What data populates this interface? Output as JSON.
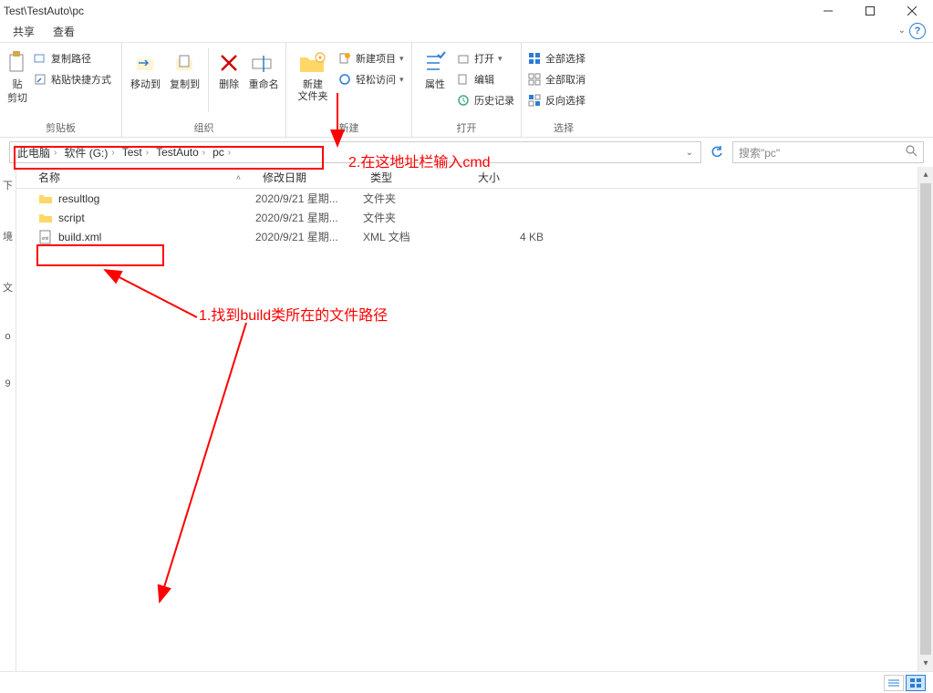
{
  "title_path": "Test\\TestAuto\\pc",
  "menubar": {
    "share": "共享",
    "view": "查看"
  },
  "ribbon": {
    "clipboard": {
      "paste": "贴",
      "cut": "剪切",
      "copy_path": "复制路径",
      "paste_shortcut": "粘贴快捷方式",
      "group": "剪贴板"
    },
    "organize": {
      "move_to": "移动到",
      "copy_to": "复制到",
      "delete": "删除",
      "rename": "重命名",
      "group": "组织"
    },
    "new": {
      "new_folder": "新建\n文件夹",
      "new_item": "新建项目",
      "easy_access": "轻松访问",
      "group": "新建"
    },
    "open_grp": {
      "properties": "属性",
      "open": "打开",
      "edit": "编辑",
      "history": "历史记录",
      "group": "打开"
    },
    "select": {
      "select_all": "全部选择",
      "select_none": "全部取消",
      "invert": "反向选择",
      "group": "选择"
    }
  },
  "breadcrumbs": [
    "此电脑",
    "软件 (G:)",
    "Test",
    "TestAuto",
    "pc"
  ],
  "search_placeholder": "搜索\"pc\"",
  "columns": {
    "name": "名称",
    "date": "修改日期",
    "type": "类型",
    "size": "大小"
  },
  "files": [
    {
      "name": "resultlog",
      "date": "2020/9/21 星期...",
      "type": "文件夹",
      "size": "",
      "icon": "folder"
    },
    {
      "name": "script",
      "date": "2020/9/21 星期...",
      "type": "文件夹",
      "size": "",
      "icon": "folder"
    },
    {
      "name": "build.xml",
      "date": "2020/9/21 星期...",
      "type": "XML 文档",
      "size": "4 KB",
      "icon": "xml"
    }
  ],
  "leftstrip": [
    "下",
    "境",
    "文",
    "o",
    "9"
  ],
  "annotations": {
    "a1": "1.找到build类所在的文件路径",
    "a2": "2.在这地址栏输入cmd"
  },
  "status": {
    "left": "",
    "right": ""
  }
}
